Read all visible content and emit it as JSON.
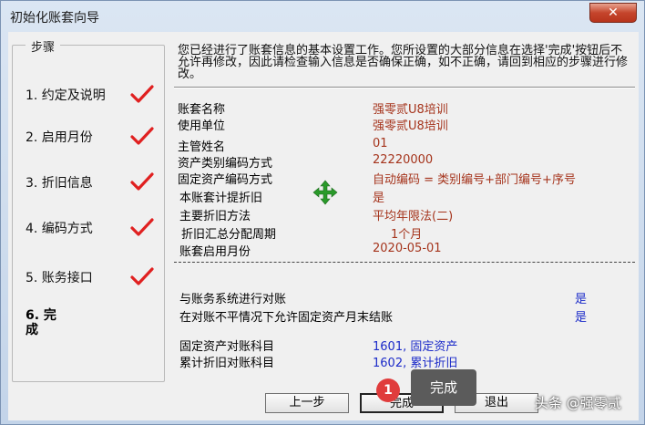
{
  "window": {
    "title": "初始化账套向导",
    "close_label": "✕"
  },
  "steps": {
    "legend": "步骤",
    "items": [
      {
        "label": "1. 约定及说明",
        "done": true
      },
      {
        "label": "2. 启用月份",
        "done": true
      },
      {
        "label": "3. 折旧信息",
        "done": true
      },
      {
        "label": "4. 编码方式",
        "done": true
      },
      {
        "label": "5. 账务接口",
        "done": true
      }
    ],
    "current": "6. 完成"
  },
  "description": "您已经进行了账套信息的基本设置工作。您所设置的大部分信息在选择'完成'按钮后不允许再修改，因此请检查输入信息是否确保正确，如不正确，请回到相应的步骤进行修改。",
  "summary": [
    {
      "label": "账套名称",
      "value": "强零贰U8培训"
    },
    {
      "label": "使用单位",
      "value": "强零贰U8培训"
    },
    {
      "label": "主管姓名",
      "value": "01"
    },
    {
      "label": "资产类别编码方式",
      "value": "22220000"
    },
    {
      "label": "固定资产编码方式",
      "value": "自动编码 = 类别编号+部门编号+序号"
    },
    {
      "label": "本账套计提折旧",
      "value": "是"
    },
    {
      "label": "主要折旧方法",
      "value": "平均年限法(二)"
    },
    {
      "label": "折旧汇总分配周期",
      "value": "1个月"
    },
    {
      "label": "账套启用月份",
      "value": "2020-05-01"
    }
  ],
  "reconcile": [
    {
      "label": "与账务系统进行对账",
      "value": "是"
    },
    {
      "label": "在对账不平情况下允许固定资产月末结账",
      "value": "是"
    }
  ],
  "accounts": [
    {
      "label": "固定资产对账科目",
      "value": "1601, 固定资产"
    },
    {
      "label": "累计折旧对账科目",
      "value": "1602, 累计折旧"
    }
  ],
  "buttons": {
    "prev": "上一步",
    "finish": "完成",
    "exit": "退出"
  },
  "annotation": {
    "badge": "1",
    "tooltip": "完成"
  },
  "watermark": "头条 @强零贰",
  "icons": {
    "close": "close-icon",
    "check": "checkmark-icon",
    "move": "move-cursor-icon"
  },
  "colors": {
    "value_red": "#a5341c",
    "value_blue": "#1c2bc9",
    "check_red": "#e02020",
    "move_green": "#2a9a2a"
  }
}
